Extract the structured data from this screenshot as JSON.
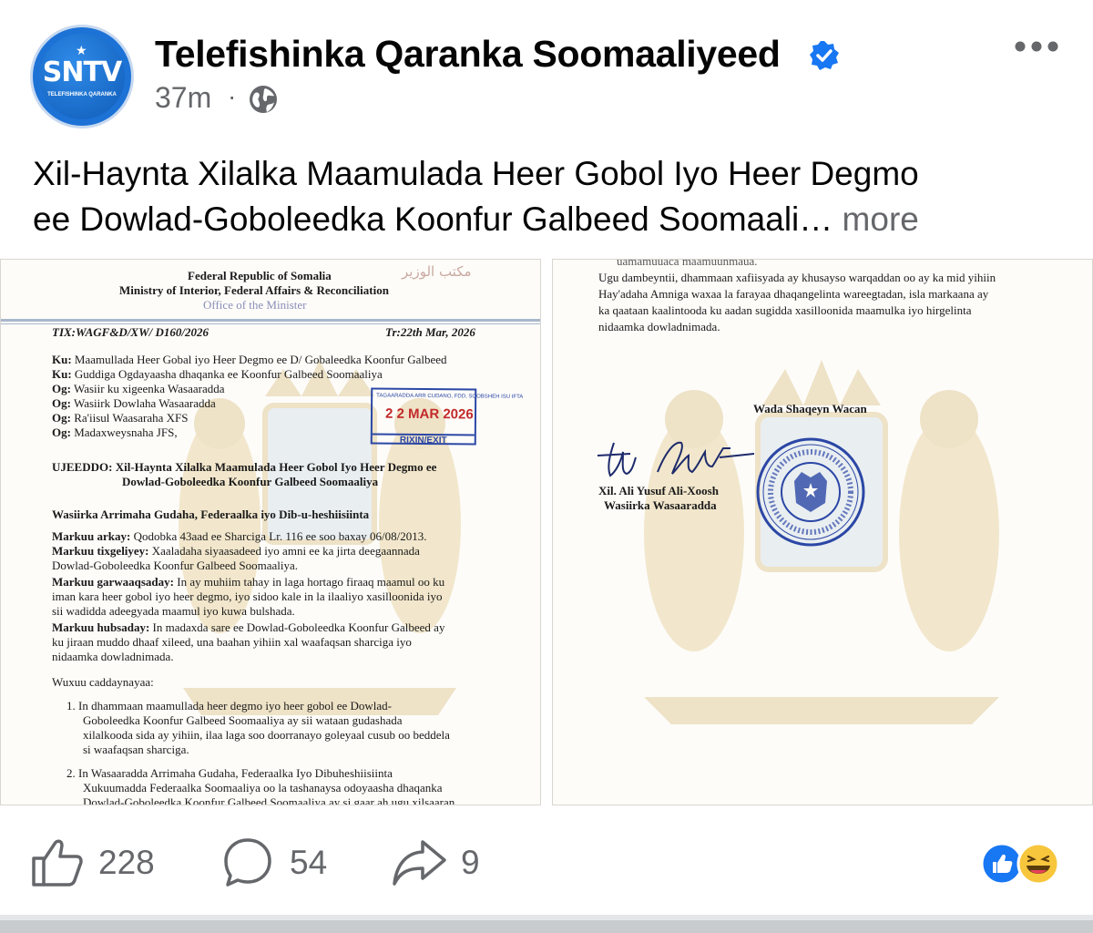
{
  "post": {
    "page_name": "Telefishinka Qaranka Soomaaliyeed",
    "avatar_text": "SNTV",
    "avatar_subtext": "TELEFISHINKA QARANKA",
    "time": "37m",
    "separator": "·",
    "privacy_icon": "globe-icon",
    "verified_icon": "verified-badge-icon",
    "options_icon": "more-options-icon",
    "caption_line1": "Xil-Haynta Xilalka Maamulada Heer Gobol Iyo Heer Degmo",
    "caption_line2": "ee Dowlad-Goboleedka Koonfur Galbeed Soomaali…",
    "more_link": "more"
  },
  "doc_left": {
    "arabic": "مكتب الوزير",
    "org1": "Federal Republic of Somalia",
    "org2": "Ministry of Interior, Federal Affairs & Reconciliation",
    "org3": "Office of the Minister",
    "ref": "TIX:WAGF&D/XW/ D160/2026",
    "date": "Tr:22th Mar, 2026",
    "to1_label": "Ku:",
    "to1": "Maamullada Heer Gobal iyo Heer Degmo ee D/ Gobaleedka Koonfur Galbeed",
    "to2_label": "Ku:",
    "to2": "Guddiga Ogdayaasha dhaqanka ee Koonfur Galbeed Soomaaliya",
    "cc1_label": "Og:",
    "cc1": "Wasiir ku xigeenka Wasaaradda",
    "cc2_label": "Og:",
    "cc2": "Wasiirk Dowlaha Wasaaradda",
    "cc3_label": "Og:",
    "cc3": "Ra'iisul Waasaraha XFS",
    "cc4_label": "Og:",
    "cc4": "Madaxweysnaha JFS,",
    "subject_label": "UJEEDDO:",
    "subject1": "Xil-Haynta Xilalka Maamulada Heer Gobol Iyo Heer Degmo ee",
    "subject2": "Dowlad-Goboleedka Koonfur Galbeed Soomaaliya",
    "minister_title": "Wasiirka Arrimaha Gudaha, Federaalka iyo Dib-u-heshiisiinta",
    "p1_label": "Markuu arkay:",
    "p1": "Qodobka 43aad ee Sharciga Lr. 116 ee soo baxay 06/08/2013.",
    "p2_label": "Markuu tixgeliyey:",
    "p2a": "Xaaladaha siyaasadeed iyo amni ee ka jirta deegaannada",
    "p2b": "Dowlad-Goboleedka Koonfur Galbeed Soomaaliya.",
    "p3_label": "Markuu garwaaqsaday:",
    "p3a": "In ay muhiim tahay in laga hortago firaaq maamul oo ku",
    "p3b": "iman kara heer gobol iyo heer degmo, iyo sidoo kale in la ilaaliyo xasilloonida iyo",
    "p3c": "sii wadidda adeegyada maamul iyo kuwa bulshada.",
    "p4_label": "Markuu hubsaday:",
    "p4a": "In madaxda sare ee Dowlad-Goboleedka Koonfur Galbeed ay",
    "p4b": "ku jiraan muddo dhaaf xileed, una baahan yihiin xal waafaqsan sharciga iyo",
    "p4c": "nidaamka dowladnimada.",
    "declares": "Wuxuu caddaynayaa:",
    "item1a": "1.  In dhammaan maamullada heer degmo iyo heer gobol ee Dowlad-",
    "item1b": "Goboleedka Koonfur Galbeed Soomaaliya ay sii wataan gudashada",
    "item1c": "xilalkooda sida ay yihiin, ilaa laga soo doorranayo goleyaal cusub oo beddela",
    "item1d": "si waafaqsan sharciga.",
    "item2a": "2.  In Wasaaradda Arrimaha Gudaha, Federaalka Iyo Dibuheshiisiinta",
    "item2b": "Xukuumadda Federaalka Soomaaliya oo la tashanaysa odoyaasha dhaqanka",
    "item2c": "Dowlad-Goboleedka Koonfur Galbeed Soomaaliya ay si gaar ah ugu xilsaaran",
    "stamp_top": "TAGAARADDA ARR CUDANO, FDD, SOOBSHEH ISU IFTA",
    "stamp_date": "2 2 MAR 2026",
    "stamp_exit": "RIXIN/EXIT"
  },
  "doc_right": {
    "top_fragment": "uamamuuaca maamuunmaua.",
    "l1": "Ugu dambeyntii, dhammaan xafiisyada ay khusayso warqaddan oo ay ka mid yihiin",
    "l2": "Hay'adaha Amniga  waxaa la farayaa dhaqangelinta wareegtadan, isla markaana ay",
    "l3": "ka qaataan kaalintooda ku aadan sugidda xasilloonida maamulka iyo hirgelinta",
    "l4": "nidaamka dowladnimada.",
    "closing": "Wada Shaqeyn Wacan",
    "signer": "Xil. Ali Yusuf Ali-Xoosh",
    "signer_title": "Wasiirka Wasaaradda"
  },
  "actions": {
    "like_icon": "like-icon",
    "like_count": "228",
    "comment_icon": "comment-icon",
    "comment_count": "54",
    "share_icon": "share-icon",
    "share_count": "9",
    "reaction_icons": [
      "like-reaction-icon",
      "haha-reaction-icon"
    ]
  },
  "colors": {
    "text_primary": "#050505",
    "text_secondary": "#65676b",
    "verified_blue": "#1877f2",
    "stamp_blue": "#2b47a5",
    "stamp_red": "#c22a2a"
  }
}
